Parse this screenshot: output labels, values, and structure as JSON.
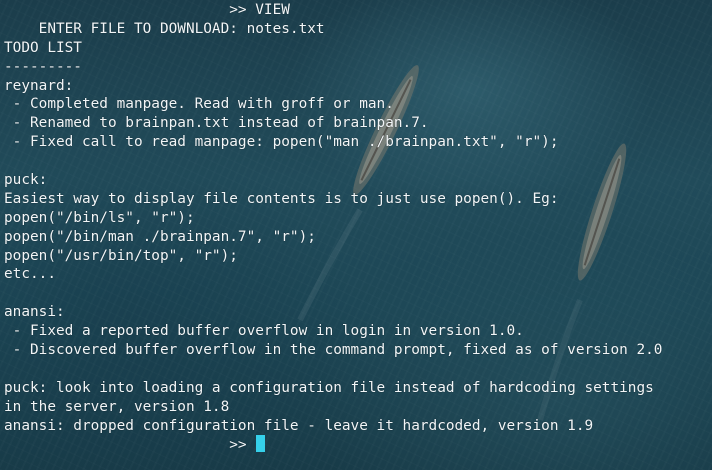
{
  "terminal": {
    "lines": [
      "                          >> VIEW",
      "    ENTER FILE TO DOWNLOAD: notes.txt",
      "TODO LIST",
      "---------",
      "reynard:",
      " - Completed manpage. Read with groff or man.",
      " - Renamed to brainpan.txt instead of brainpan.7.",
      " - Fixed call to read manpage: popen(\"man ./brainpan.txt\", \"r\");",
      "",
      "puck:",
      "Easiest way to display file contents is to just use popen(). Eg:",
      "popen(\"/bin/ls\", \"r\");",
      "popen(\"/bin/man ./brainpan.7\", \"r\");",
      "popen(\"/usr/bin/top\", \"r\");",
      "etc...",
      "",
      "anansi:",
      " - Fixed a reported buffer overflow in login in version 1.0.",
      " - Discovered buffer overflow in the command prompt, fixed as of version 2.0",
      "",
      "puck: look into loading a configuration file instead of hardcoding settings",
      "in the server, version 1.8",
      "anansi: dropped configuration file - leave it hardcoded, version 1.9"
    ],
    "prompt": "                          >> "
  },
  "colors": {
    "text": "#f2f6f8",
    "cursor": "#35d0ea",
    "background": "#1f4655"
  }
}
